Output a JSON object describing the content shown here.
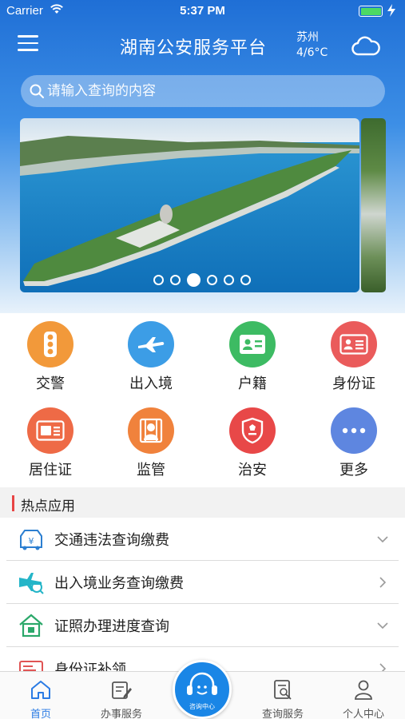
{
  "status_bar": {
    "carrier": "Carrier",
    "time": "5:37 PM"
  },
  "header": {
    "title": "湖南公安服务平台",
    "weather": {
      "city": "苏州",
      "temperature": "4/6°C"
    }
  },
  "search": {
    "placeholder": "请输入查询的内容"
  },
  "carousel": {
    "page_count": 6,
    "active_index": 2
  },
  "services": [
    {
      "label": "交警",
      "icon": "traffic-light-icon",
      "color": "#f2993a"
    },
    {
      "label": "出入境",
      "icon": "airplane-icon",
      "color": "#3c9de6"
    },
    {
      "label": "户籍",
      "icon": "id-card-icon",
      "color": "#3dbb63"
    },
    {
      "label": "身份证",
      "icon": "identity-card-icon",
      "color": "#ea5b5b"
    },
    {
      "label": "居住证",
      "icon": "residence-permit-icon",
      "color": "#ee6a46"
    },
    {
      "label": "监管",
      "icon": "detainee-icon",
      "color": "#f0823c"
    },
    {
      "label": "治安",
      "icon": "police-badge-icon",
      "color": "#e84848"
    },
    {
      "label": "更多",
      "icon": "more-icon",
      "color": "#5e86e0"
    }
  ],
  "hot_apps": {
    "heading": "热点应用",
    "items": [
      {
        "label": "交通违法查询缴费",
        "icon": "traffic-fine-icon",
        "arrow": "chevron-down-icon"
      },
      {
        "label": "出入境业务查询缴费",
        "icon": "plane-search-icon",
        "arrow": "chevron-right-icon"
      },
      {
        "label": "证照办理进度查询",
        "icon": "house-icon",
        "arrow": "chevron-down-icon"
      },
      {
        "label": "身份证补领",
        "icon": "id-card-icon",
        "arrow": "chevron-right-icon"
      }
    ]
  },
  "tab_bar": {
    "tabs": [
      {
        "label": "首页",
        "icon": "home-icon",
        "active": true
      },
      {
        "label": "办事服务",
        "icon": "service-icon",
        "active": false
      },
      {
        "label": "查询服务",
        "icon": "query-icon",
        "active": false
      },
      {
        "label": "个人中心",
        "icon": "person-icon",
        "active": false
      }
    ],
    "center": {
      "label": "咨询中心",
      "icon": "headset-icon"
    }
  },
  "colors": {
    "accent": "#2a7be4",
    "section_marker": "#e84444",
    "battery": "#4cd964"
  }
}
